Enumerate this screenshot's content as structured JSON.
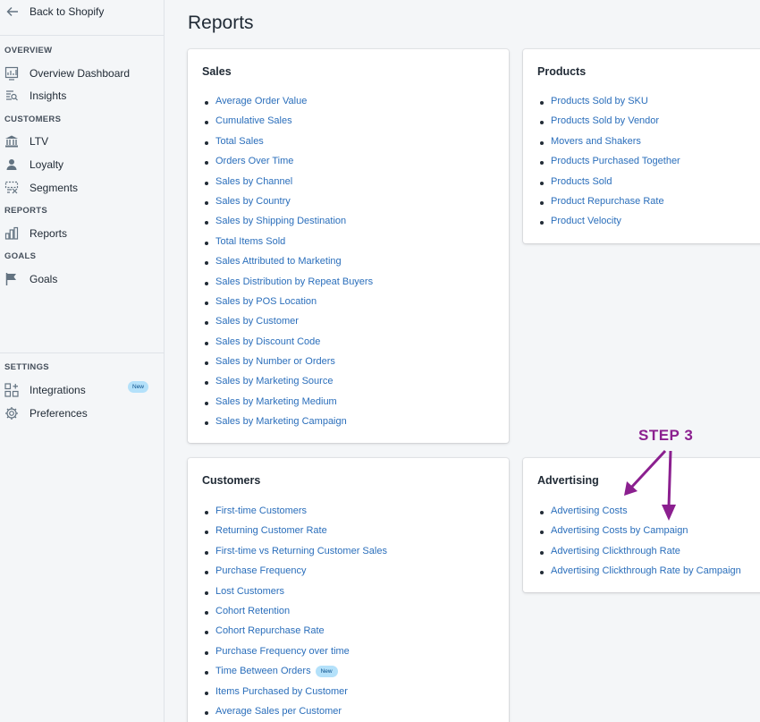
{
  "sidebar": {
    "back_label": "Back to Shopify",
    "sections": {
      "overview": "OVERVIEW",
      "customers": "CUSTOMERS",
      "reports": "REPORTS",
      "goals": "GOALS",
      "settings": "SETTINGS"
    },
    "items": {
      "overview_dashboard": "Overview Dashboard",
      "insights": "Insights",
      "ltv": "LTV",
      "loyalty": "Loyalty",
      "segments": "Segments",
      "reports": "Reports",
      "goals": "Goals",
      "integrations": "Integrations",
      "integrations_badge": "New",
      "preferences": "Preferences"
    }
  },
  "page": {
    "title": "Reports"
  },
  "cards": {
    "sales": {
      "title": "Sales",
      "links": [
        "Average Order Value",
        "Cumulative Sales",
        "Total Sales",
        "Orders Over Time",
        "Sales by Channel",
        "Sales by Country",
        "Sales by Shipping Destination",
        "Total Items Sold",
        "Sales Attributed to Marketing",
        "Sales Distribution by Repeat Buyers",
        "Sales by POS Location",
        "Sales by Customer",
        "Sales by Discount Code",
        "Sales by Number or Orders",
        "Sales by Marketing Source",
        "Sales by Marketing Medium",
        "Sales by Marketing Campaign"
      ]
    },
    "products": {
      "title": "Products",
      "links": [
        "Products Sold by SKU",
        "Products Sold by Vendor",
        "Movers and Shakers",
        "Products Purchased Together",
        "Products Sold",
        "Product Repurchase Rate",
        "Product Velocity"
      ]
    },
    "customers": {
      "title": "Customers",
      "links": [
        "First-time Customers",
        "Returning Customer Rate",
        "First-time vs Returning Customer Sales",
        "Purchase Frequency",
        "Lost Customers",
        "Cohort Retention",
        "Cohort Repurchase Rate",
        "Purchase Frequency over time",
        "Time Between Orders",
        "Items Purchased by Customer",
        "Average Sales per Customer"
      ],
      "new_badge": "New"
    },
    "advertising": {
      "title": "Advertising",
      "links": [
        "Advertising Costs",
        "Advertising Costs by Campaign",
        "Advertising Clickthrough Rate",
        "Advertising Clickthrough Rate by Campaign"
      ]
    }
  },
  "annotation": {
    "step_label": "STEP 3",
    "color": "#8b1f8f"
  },
  "colors": {
    "link": "#2a6ebb",
    "badge_bg": "#b4e1fa",
    "sidebar_bg": "#f4f6f8"
  }
}
